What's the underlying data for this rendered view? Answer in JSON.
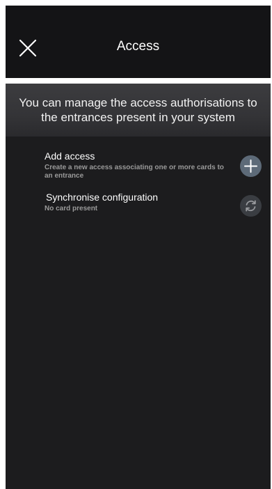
{
  "header": {
    "title": "Access",
    "close_icon": "close-icon"
  },
  "banner": {
    "text": "You can manage the access authorisations to the entrances present in your system"
  },
  "options": [
    {
      "title": "Add access",
      "description": "Create a new access associating one or more cards to an entrance",
      "icon": "plus-icon",
      "enabled": true
    },
    {
      "title": "Synchronise configuration",
      "description": "No card present",
      "icon": "sync-icon",
      "enabled": false
    }
  ],
  "colors": {
    "background": "#1c1c1e",
    "header": "#141416",
    "add_button": "#5d6a78",
    "sync_button": "#3a3d42",
    "description_text": "#9a9a9a"
  }
}
